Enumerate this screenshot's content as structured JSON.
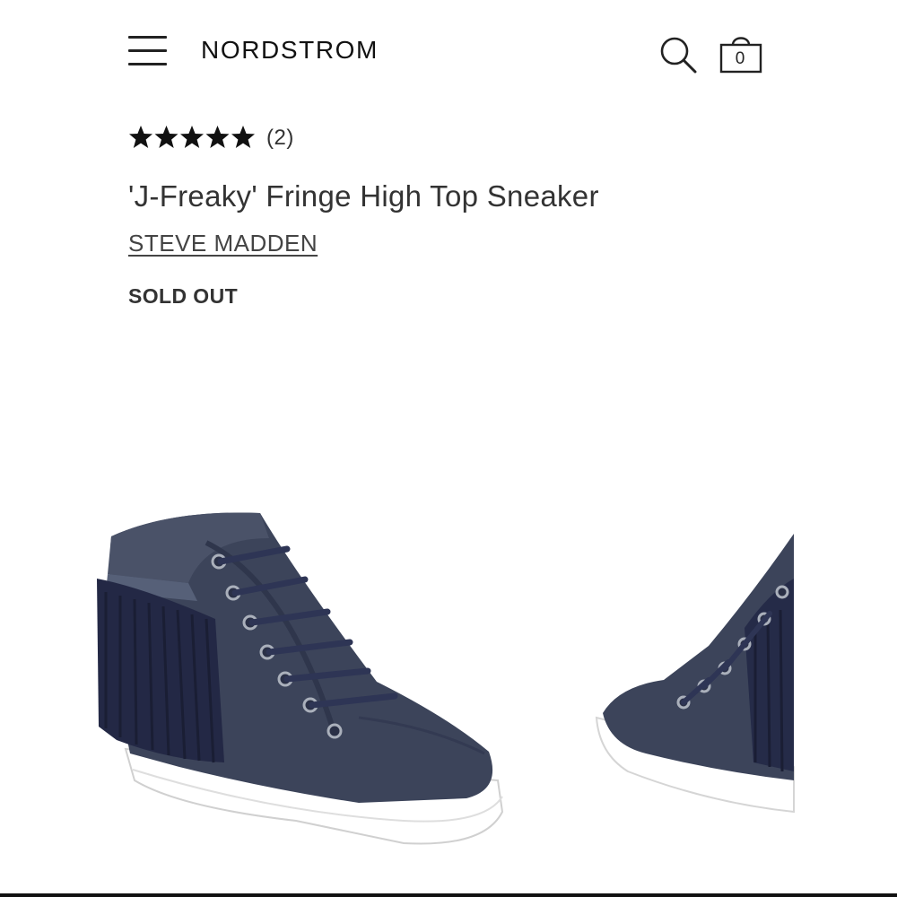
{
  "header": {
    "logo_text": "NORDSTROM",
    "menu_icon": "hamburger-menu-icon",
    "search_icon": "search-icon",
    "bag_icon": "shopping-bag-icon",
    "bag_count": "0"
  },
  "product": {
    "rating_stars": 5,
    "review_count": "(2)",
    "title": "'J-Freaky' Fringe High Top Sneaker",
    "brand": "STEVE MADDEN",
    "status": "SOLD OUT"
  },
  "gallery": {
    "images": [
      {
        "name": "product-image-side-view",
        "color": "#3a4256"
      },
      {
        "name": "product-image-alternate-view",
        "color": "#3a4256"
      }
    ]
  }
}
